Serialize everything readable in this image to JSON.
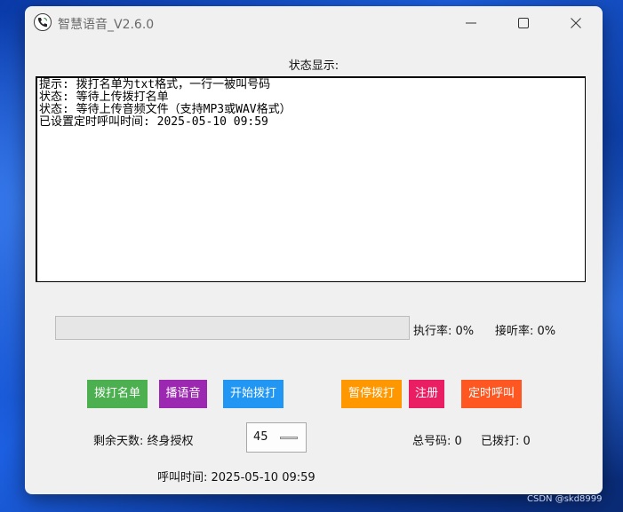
{
  "window": {
    "title": "智慧语音_V2.6.0"
  },
  "status": {
    "heading": "状态显示:",
    "log": [
      "提示: 拨打名单为txt格式，一行一被叫号码",
      "状态: 等待上传拨打名单",
      "状态: 等待上传音频文件（支持MP3或WAV格式）",
      "已设置定时呼叫时间: 2025-05-10 09:59"
    ]
  },
  "progress": {
    "value_percent": 0,
    "exec_rate": "执行率: 0%",
    "answer_rate": "接听率: 0%"
  },
  "buttons": {
    "dial_list": "拨打名单",
    "play_audio": "播语音",
    "start_dial": "开始拨打",
    "pause_dial": "暂停拨打",
    "register": "注册",
    "timed_call": "定时呼叫"
  },
  "info": {
    "remaining_days": "剩余天数: 终身授权",
    "concurrency": "45",
    "total_numbers": "总号码: 0",
    "dialed": "已拨打: 0",
    "call_time": "呼叫时间: 2025-05-10 09:59"
  },
  "watermark": "CSDN @skd8999",
  "colors": {
    "dial_list": "#4caf50",
    "play_audio": "#9c27b0",
    "start_dial": "#2196f3",
    "pause_dial": "#ff9800",
    "register": "#e91e63",
    "timed_call": "#ff5722"
  },
  "icons": {
    "app": "phone-icon",
    "minimize": "minimize-icon",
    "maximize": "maximize-icon",
    "close": "close-icon"
  }
}
